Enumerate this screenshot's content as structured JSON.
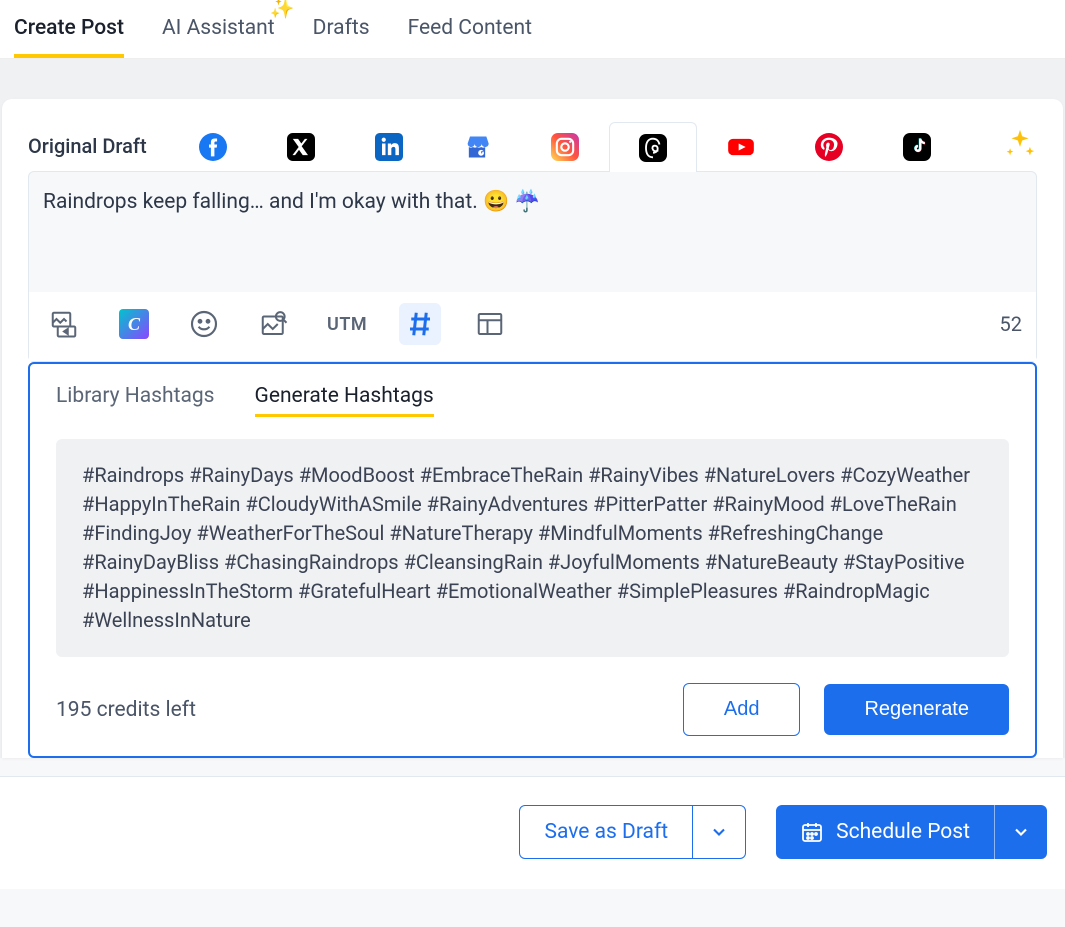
{
  "top_tabs": {
    "create_post": "Create Post",
    "ai_assistant": "AI Assistant",
    "drafts": "Drafts",
    "feed_content": "Feed Content"
  },
  "channel_label": "Original Draft",
  "editor_text": "Raindrops keep falling… and I'm okay with that. 😀 ☔",
  "utm_label": "UTM",
  "char_count": "52",
  "hashtag_tabs": {
    "library": "Library Hashtags",
    "generate": "Generate Hashtags"
  },
  "hashtags_text": "#Raindrops #RainyDays #MoodBoost #EmbraceTheRain #RainyVibes #NatureLovers #CozyWeather #HappyInTheRain #CloudyWithASmile #RainyAdventures #PitterPatter #RainyMood #LoveTheRain #FindingJoy #WeatherForTheSoul #NatureTherapy #MindfulMoments #RefreshingChange #RainyDayBliss #ChasingRaindrops #CleansingRain #JoyfulMoments #NatureBeauty #StayPositive #HappinessInTheStorm #GratefulHeart #EmotionalWeather #SimplePleasures #RaindropMagic #WellnessInNature",
  "credits_text": "195 credits left",
  "add_label": "Add",
  "regenerate_label": "Regenerate",
  "save_draft_label": "Save as Draft",
  "schedule_label": "Schedule Post"
}
